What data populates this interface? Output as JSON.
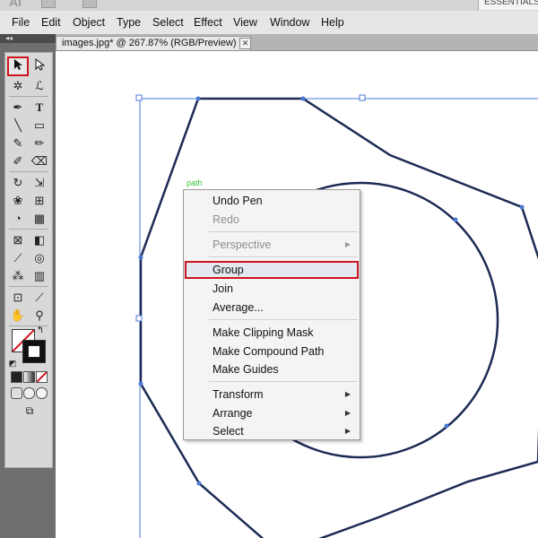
{
  "app": {
    "logo": "Ai",
    "workspace_label": "ESSENTIALS"
  },
  "menubar": {
    "items": [
      "File",
      "Edit",
      "Object",
      "Type",
      "Select",
      "Effect",
      "View",
      "Window",
      "Help"
    ]
  },
  "tool_panel": {
    "collapse_label": "◂◂"
  },
  "document_tab": {
    "title": "images.jpg* @ 267.87% (RGB/Preview)",
    "close_glyph": "✕"
  },
  "canvas": {
    "path_hint_label": "path",
    "shape_stroke_color": "#1c2a55",
    "anchor_color": "#4a78d6"
  },
  "context_menu": {
    "items": [
      {
        "label": "Undo Pen",
        "enabled": true
      },
      {
        "label": "Redo",
        "enabled": false
      },
      {
        "label": "Perspective",
        "enabled": false,
        "submenu": true
      },
      {
        "label": "Group",
        "enabled": true,
        "highlighted": true
      },
      {
        "label": "Join",
        "enabled": true
      },
      {
        "label": "Average...",
        "enabled": true
      },
      {
        "label": "Make Clipping Mask",
        "enabled": true
      },
      {
        "label": "Make Compound Path",
        "enabled": true
      },
      {
        "label": "Make Guides",
        "enabled": true
      },
      {
        "label": "Transform",
        "enabled": true,
        "submenu": true
      },
      {
        "label": "Arrange",
        "enabled": true,
        "submenu": true
      },
      {
        "label": "Select",
        "enabled": true,
        "submenu": true
      }
    ],
    "submenu_glyph": "▶"
  },
  "colors": {
    "highlight_red": "#d0151e",
    "panel_gray": "#6e6e6e",
    "menu_bg": "#f4f4f4"
  }
}
